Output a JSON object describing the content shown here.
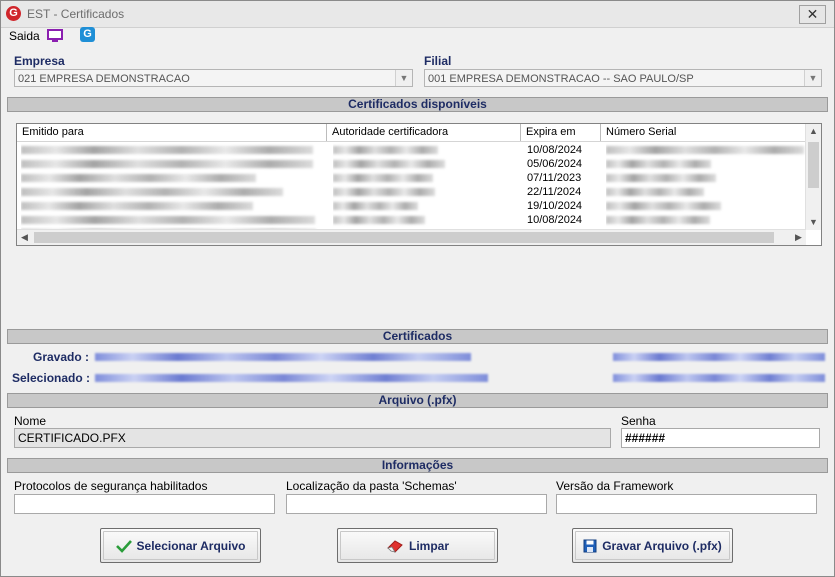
{
  "window": {
    "title": "EST - Certificados",
    "close_glyph": "✕"
  },
  "menu": {
    "saida_label": "Saida",
    "icons": [
      "monitor-icon",
      "g-app-icon"
    ]
  },
  "empresa": {
    "label": "Empresa",
    "value": "021 EMPRESA DEMONSTRACAO"
  },
  "filial": {
    "label": "Filial",
    "value": "001 EMPRESA DEMONSTRACAO -- SAO PAULO/SP"
  },
  "certificados_disponiveis": {
    "title": "Certificados disponíveis",
    "columns": [
      "Emitido para",
      "Autoridade certificadora",
      "Expira em",
      "Número Serial"
    ],
    "rows": [
      {
        "expira": "10/08/2024"
      },
      {
        "expira": "05/06/2024"
      },
      {
        "expira": "07/11/2023"
      },
      {
        "expira": "22/11/2024"
      },
      {
        "expira": "19/10/2024"
      },
      {
        "expira": "10/08/2024"
      }
    ]
  },
  "certificados": {
    "title": "Certificados",
    "gravado_label": "Gravado :",
    "selecionado_label": "Selecionado :"
  },
  "arquivo": {
    "title": "Arquivo (.pfx)",
    "nome_label": "Nome",
    "nome_value": "CERTIFICADO.PFX",
    "senha_label": "Senha",
    "senha_value": "######"
  },
  "informacoes": {
    "title": "Informações",
    "protocolos_label": "Protocolos de segurança habilitados",
    "schemas_label": "Localização da pasta 'Schemas'",
    "framework_label": "Versão da Framework"
  },
  "buttons": {
    "selecionar": "Selecionar Arquivo",
    "limpar": "Limpar",
    "gravar": "Gravar Arquivo (.pfx)"
  },
  "colors": {
    "label_blue": "#1e2c64",
    "section_gray": "#c8c8c8",
    "check_green": "#2a9d3a",
    "eraser_red": "#e0302c",
    "save_blue": "#1f5fb8"
  }
}
